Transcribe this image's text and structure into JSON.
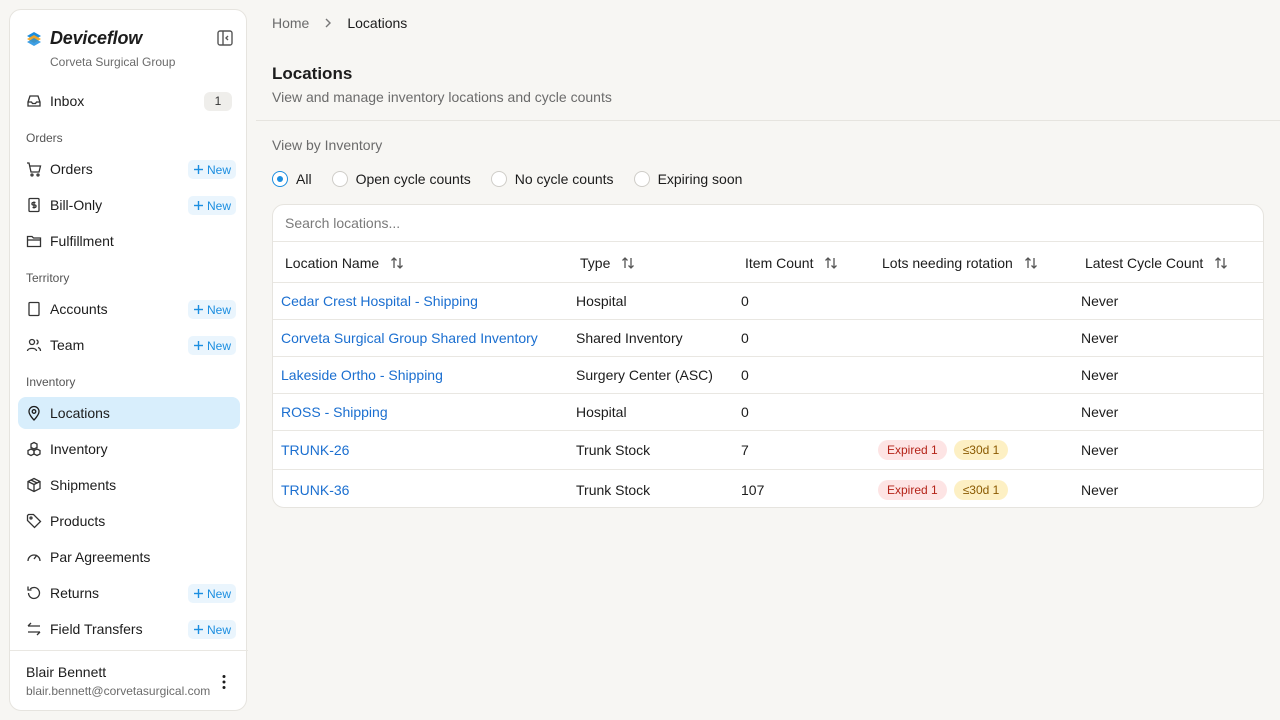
{
  "sidebar": {
    "brand": "Deviceflow",
    "org": "Corveta Surgical Group",
    "inbox": {
      "label": "Inbox",
      "count": "1"
    },
    "sections": {
      "orders": "Orders",
      "territory": "Territory",
      "inventory": "Inventory"
    },
    "items": {
      "orders": "Orders",
      "bill_only": "Bill-Only",
      "fulfillment": "Fulfillment",
      "accounts": "Accounts",
      "team": "Team",
      "locations": "Locations",
      "inventory": "Inventory",
      "shipments": "Shipments",
      "products": "Products",
      "par_agreements": "Par Agreements",
      "returns": "Returns",
      "field_transfers": "Field Transfers"
    },
    "new_label": "New",
    "user": {
      "name": "Blair Bennett",
      "email": "blair.bennett@corvetasurgical.com"
    }
  },
  "breadcrumb": {
    "home": "Home",
    "current": "Locations"
  },
  "page": {
    "title": "Locations",
    "subtitle": "View and manage inventory locations and cycle counts"
  },
  "filter": {
    "label": "View by Inventory",
    "options": [
      "All",
      "Open cycle counts",
      "No cycle counts",
      "Expiring soon"
    ],
    "selected": "All"
  },
  "search": {
    "placeholder": "Search locations..."
  },
  "table": {
    "columns": [
      "Location Name",
      "Type",
      "Item Count",
      "Lots needing rotation",
      "Latest Cycle Count"
    ],
    "rows": [
      {
        "name": "Cedar Crest Hospital - Shipping",
        "type": "Hospital",
        "count": "0",
        "expired": "",
        "soon": "",
        "latest": "Never"
      },
      {
        "name": "Corveta Surgical Group Shared Inventory",
        "type": "Shared Inventory",
        "count": "0",
        "expired": "",
        "soon": "",
        "latest": "Never"
      },
      {
        "name": "Lakeside Ortho - Shipping",
        "type": "Surgery Center (ASC)",
        "count": "0",
        "expired": "",
        "soon": "",
        "latest": "Never"
      },
      {
        "name": "ROSS - Shipping",
        "type": "Hospital",
        "count": "0",
        "expired": "",
        "soon": "",
        "latest": "Never"
      },
      {
        "name": "TRUNK-26",
        "type": "Trunk Stock",
        "count": "7",
        "expired": "Expired 1",
        "soon": "≤30d 1",
        "latest": "Never"
      },
      {
        "name": "TRUNK-36",
        "type": "Trunk Stock",
        "count": "107",
        "expired": "Expired 1",
        "soon": "≤30d 1",
        "latest": "Never"
      }
    ]
  },
  "colors": {
    "accent": "#1b8ee0",
    "link": "#1b6fd0",
    "active_bg": "#d8eefc",
    "expired_bg": "#fde4e4",
    "soon_bg": "#fdf0c4"
  }
}
